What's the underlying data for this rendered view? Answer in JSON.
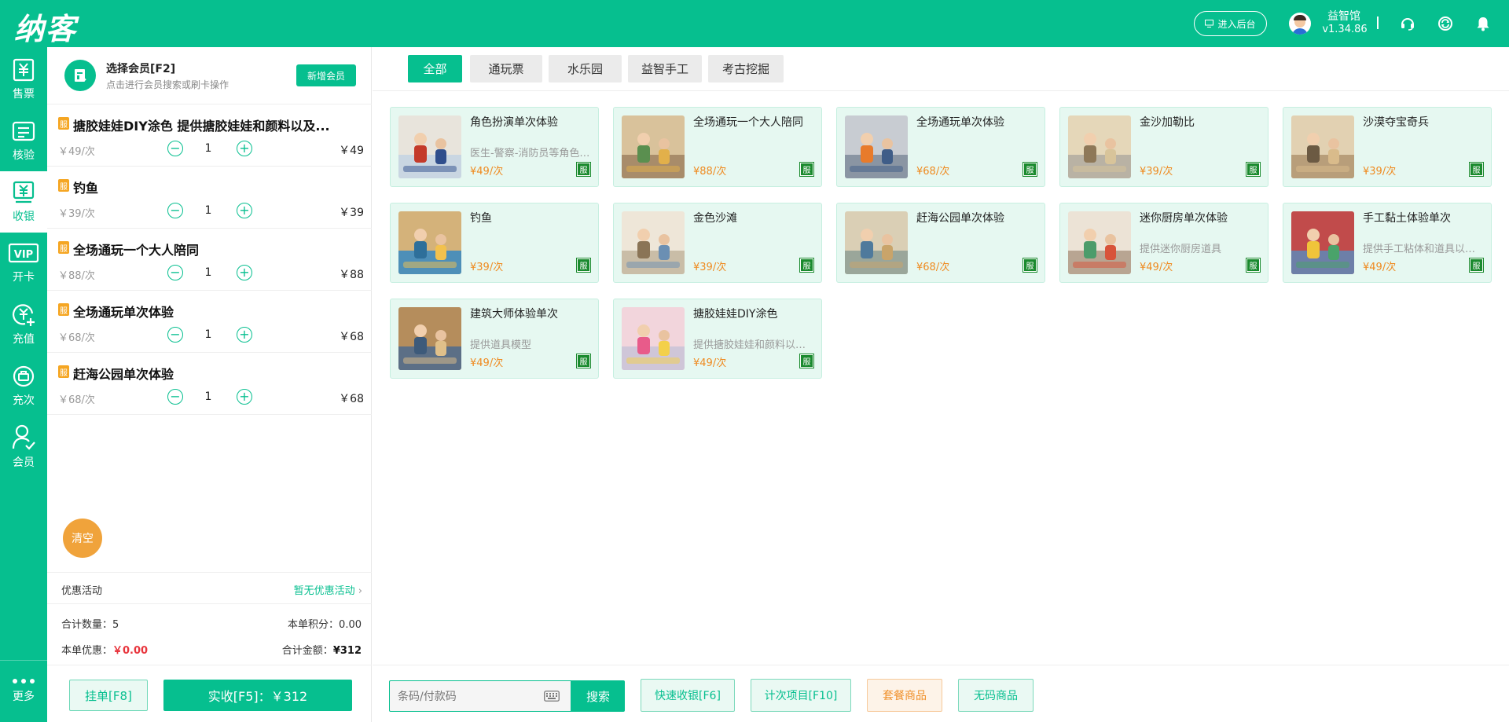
{
  "app": {
    "logo": "纳客",
    "enter_backend": "进入后台",
    "user_name": "益智馆",
    "version": "v1.34.86"
  },
  "colors": {
    "brand": "#06bf8f",
    "price": "#ef8a1f",
    "discount": "#e8353d",
    "clear": "#f0a33b"
  },
  "sidebar": {
    "items": [
      {
        "label": "售票",
        "icon": "ticket-icon"
      },
      {
        "label": "核验",
        "icon": "verify-icon"
      },
      {
        "label": "收银",
        "icon": "cashier-icon",
        "active": true
      },
      {
        "label": "开卡",
        "icon": "vip-card-icon"
      },
      {
        "label": "充值",
        "icon": "recharge-icon"
      },
      {
        "label": "充次",
        "icon": "recharge-times-icon"
      },
      {
        "label": "会员",
        "icon": "member-icon"
      }
    ],
    "more": "更多"
  },
  "member": {
    "title": "选择会员[F2]",
    "subtitle": "点击进行会员搜索或刷卡操作",
    "add_button": "新增会员"
  },
  "cart": {
    "badge": "服",
    "items": [
      {
        "name": "搪胶娃娃DIY涂色 提供搪胶娃娃和颜料以及...",
        "unit_price": "￥49/次",
        "qty": "1",
        "total": "￥49"
      },
      {
        "name": "钓鱼",
        "unit_price": "￥39/次",
        "qty": "1",
        "total": "￥39"
      },
      {
        "name": "全场通玩一个大人陪同",
        "unit_price": "￥88/次",
        "qty": "1",
        "total": "￥88"
      },
      {
        "name": "全场通玩单次体验",
        "unit_price": "￥68/次",
        "qty": "1",
        "total": "￥68"
      },
      {
        "name": "赶海公园单次体验",
        "unit_price": "￥68/次",
        "qty": "1",
        "total": "￥68"
      }
    ],
    "clear": "清空"
  },
  "summary": {
    "promo_label": "优惠活动",
    "promo_value": "暂无优惠活动",
    "count_label": "合计数量：",
    "count_value": "5",
    "points_label": "本单积分：",
    "points_value": "0.00",
    "discount_label": "本单优惠：",
    "discount_value": "￥0.00",
    "total_label": "合计金额：",
    "total_value": "¥312"
  },
  "actions": {
    "hang": "挂单[F8]",
    "pay": "实收[F5]：￥312"
  },
  "tabs": [
    {
      "label": "全部",
      "active": true
    },
    {
      "label": "通玩票"
    },
    {
      "label": "水乐园"
    },
    {
      "label": "益智手工"
    },
    {
      "label": "考古挖掘"
    }
  ],
  "products": [
    {
      "name": "角色扮演单次体验",
      "desc": "医生-警察-消防员等角色扮演",
      "price": "¥49/次",
      "tag": "服"
    },
    {
      "name": "全场通玩一个大人陪同",
      "desc": "",
      "price": "¥88/次",
      "tag": "服"
    },
    {
      "name": "全场通玩单次体验",
      "desc": "",
      "price": "¥68/次",
      "tag": "服"
    },
    {
      "name": "金沙加勒比",
      "desc": "",
      "price": "¥39/次",
      "tag": "服"
    },
    {
      "name": "沙漠夺宝奇兵",
      "desc": "",
      "price": "¥39/次",
      "tag": "服"
    },
    {
      "name": "钓鱼",
      "desc": "",
      "price": "¥39/次",
      "tag": "服"
    },
    {
      "name": "金色沙滩",
      "desc": "",
      "price": "¥39/次",
      "tag": "服"
    },
    {
      "name": "赶海公园单次体验",
      "desc": "",
      "price": "¥68/次",
      "tag": "服"
    },
    {
      "name": "迷你厨房单次体验",
      "desc": "提供迷你厨房道具",
      "price": "¥49/次",
      "tag": "服"
    },
    {
      "name": "手工黏土体验单次",
      "desc": "提供手工粘体和道具以及教学",
      "price": "¥49/次",
      "tag": "服"
    },
    {
      "name": "建筑大师体验单次",
      "desc": "提供道具模型",
      "price": "¥49/次",
      "tag": "服"
    },
    {
      "name": "搪胶娃娃DIY涂色",
      "desc": "提供搪胶娃娃和颜料以及工具",
      "price": "¥49/次",
      "tag": "服"
    }
  ],
  "bottom": {
    "search_placeholder": "条码/付款码",
    "search_button": "搜索",
    "quick_cash": "快速收银[F6]",
    "times_item": "计次项目[F10]",
    "package": "套餐商品",
    "no_code": "无码商品"
  }
}
